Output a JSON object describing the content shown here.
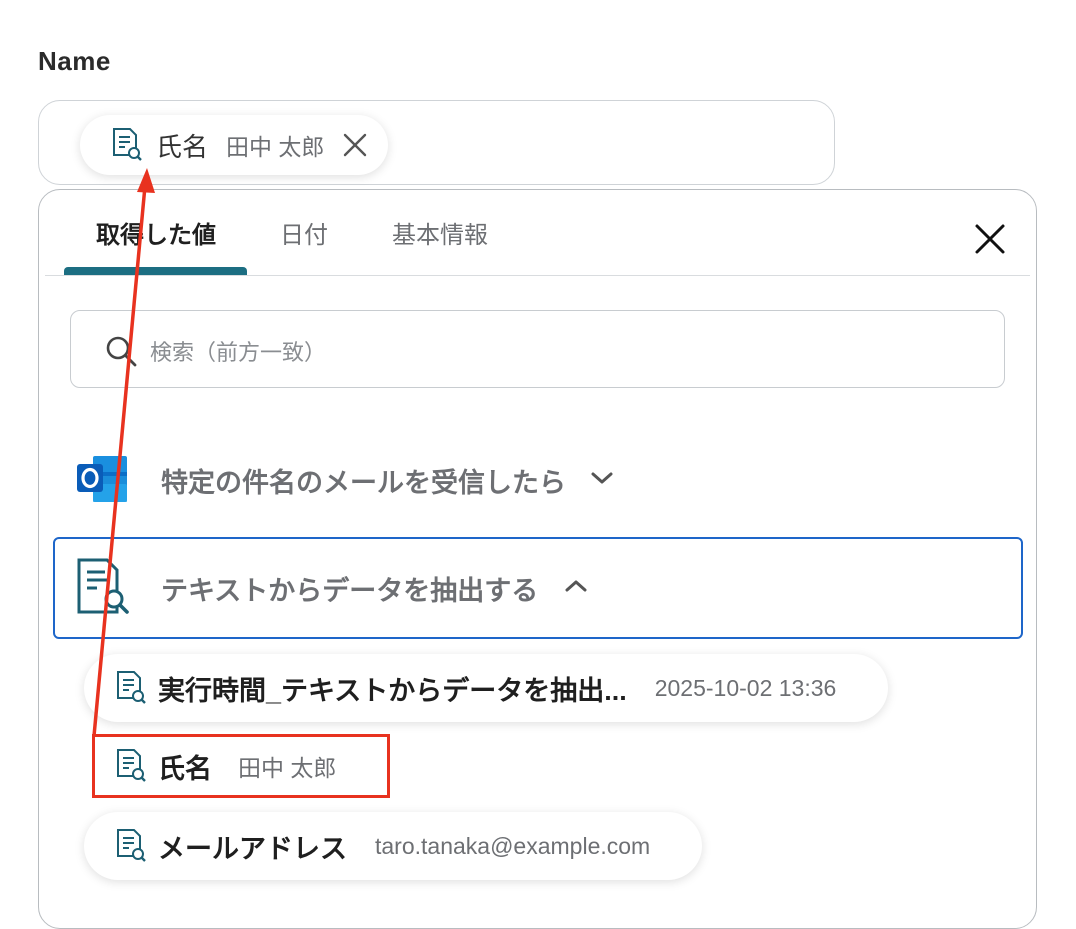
{
  "field": {
    "label": "Name"
  },
  "input_chip": {
    "key": "氏名",
    "value": "田中 太郎"
  },
  "tabs": [
    {
      "label": "取得した値",
      "active": true
    },
    {
      "label": "日付",
      "active": false
    },
    {
      "label": "基本情報",
      "active": false
    }
  ],
  "search": {
    "placeholder": "検索（前方一致）",
    "value": ""
  },
  "sections": [
    {
      "title": "特定の件名のメールを受信したら",
      "icon": "outlook-icon",
      "expanded": false
    },
    {
      "title": "テキストからデータを抽出する",
      "icon": "document-search-icon",
      "expanded": true
    }
  ],
  "items": [
    {
      "key": "実行時間_テキストからデータを抽出...",
      "value": "2025-10-02 13:36"
    },
    {
      "key": "氏名",
      "value": "田中 太郎"
    },
    {
      "key": "メールアドレス",
      "value": "taro.tanaka@example.com"
    }
  ],
  "colors": {
    "accent_tab": "#1c6e82",
    "selected_border": "#1e66c9",
    "annotation_red": "#e8321f",
    "icon_teal": "#1c5f73"
  }
}
